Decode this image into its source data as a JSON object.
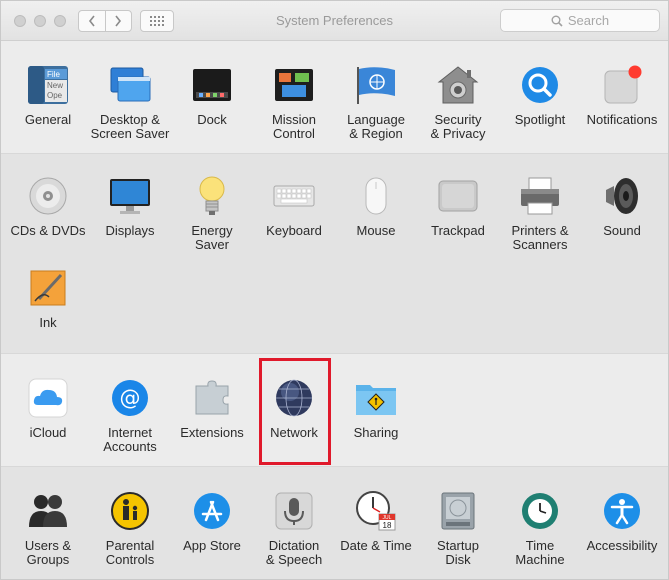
{
  "window": {
    "title": "System Preferences"
  },
  "search": {
    "placeholder": "Search"
  },
  "personal": {
    "general": "General",
    "desktop": "Desktop &\nScreen Saver",
    "dock": "Dock",
    "mission": "Mission\nControl",
    "language": "Language\n& Region",
    "security": "Security\n& Privacy",
    "spotlight": "Spotlight",
    "notifications": "Notifications",
    "general_icon_text": [
      "File",
      "New",
      "Ope"
    ]
  },
  "hardware": {
    "cds": "CDs & DVDs",
    "displays": "Displays",
    "energy": "Energy\nSaver",
    "keyboard": "Keyboard",
    "mouse": "Mouse",
    "trackpad": "Trackpad",
    "printers": "Printers &\nScanners",
    "sound": "Sound",
    "ink": "Ink"
  },
  "internet": {
    "icloud": "iCloud",
    "accounts": "Internet\nAccounts",
    "extensions": "Extensions",
    "network": "Network",
    "sharing": "Sharing"
  },
  "system": {
    "users": "Users &\nGroups",
    "parental": "Parental\nControls",
    "appstore": "App Store",
    "dictation": "Dictation\n& Speech",
    "datetime": "Date & Time",
    "startup": "Startup\nDisk",
    "timemachine": "Time\nMachine",
    "accessibility": "Accessibility",
    "calendar_month": "JUL",
    "calendar_day": "18"
  }
}
